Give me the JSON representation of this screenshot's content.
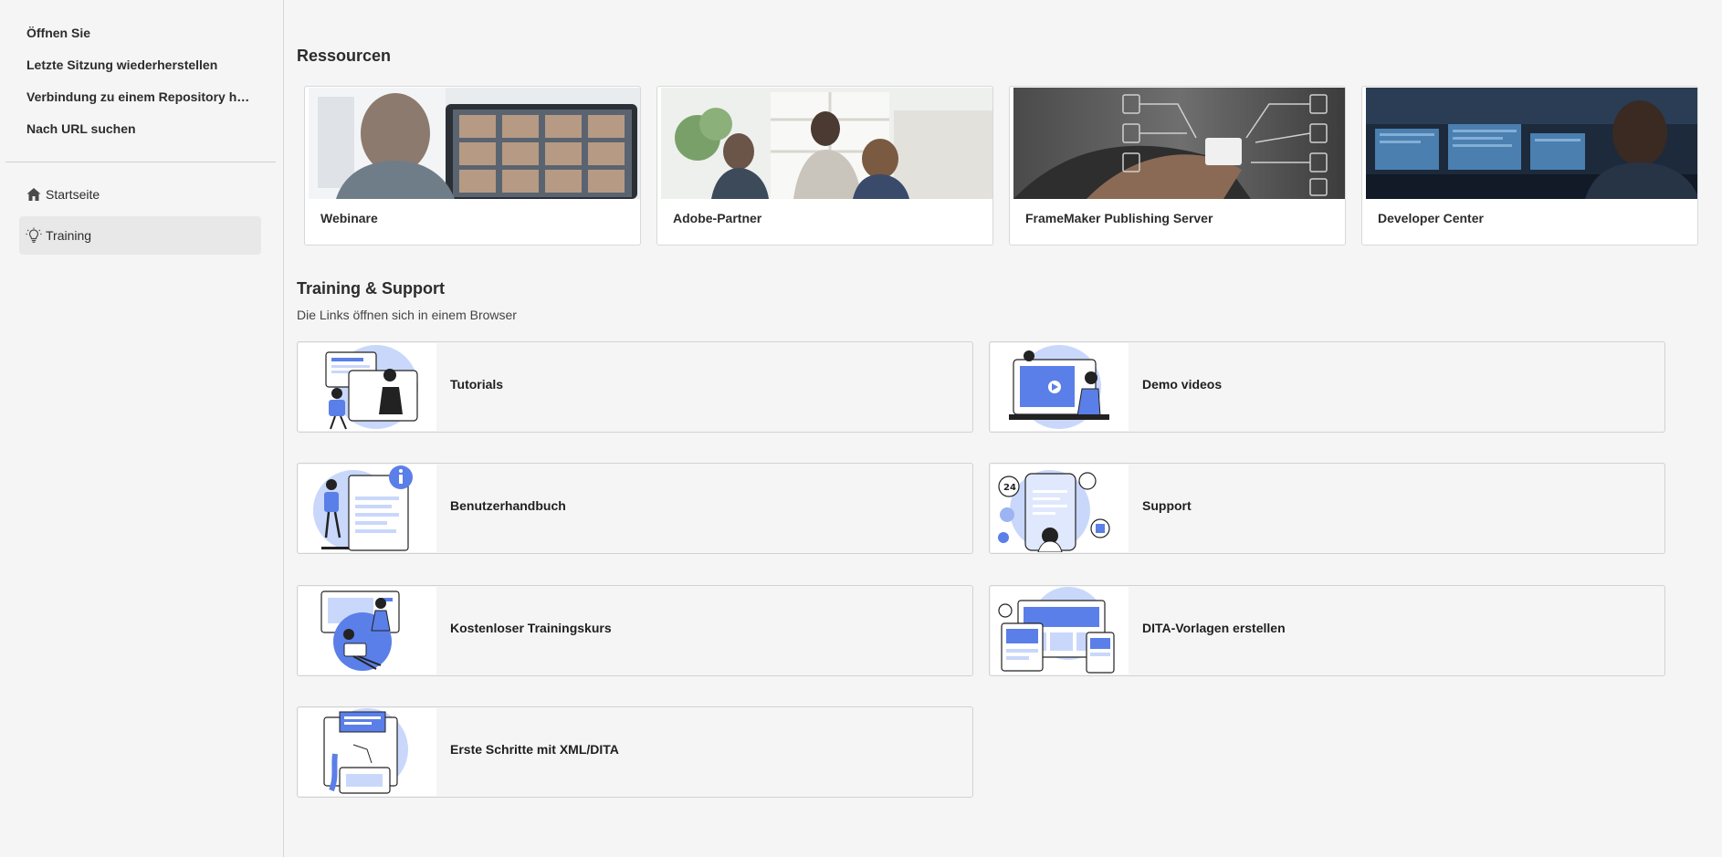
{
  "sidebar": {
    "links": [
      {
        "label": "Öffnen Sie"
      },
      {
        "label": "Letzte Sitzung wiederherstellen"
      },
      {
        "label": "Verbindung zu einem Repository herst..."
      },
      {
        "label": "Nach URL suchen"
      }
    ],
    "nav": [
      {
        "label": "Startseite",
        "icon": "home-icon",
        "active": false
      },
      {
        "label": "Training",
        "icon": "lightbulb-icon",
        "active": true
      }
    ]
  },
  "resources": {
    "title": "Ressourcen",
    "cards": [
      {
        "label": "Webinare"
      },
      {
        "label": "Adobe-Partner"
      },
      {
        "label": "FrameMaker Publishing Server"
      },
      {
        "label": "Developer Center"
      }
    ]
  },
  "training": {
    "title": "Training & Support",
    "subtitle": "Die Links öffnen sich in einem Browser",
    "cards": [
      {
        "label": "Tutorials"
      },
      {
        "label": "Demo videos"
      },
      {
        "label": "Benutzerhandbuch"
      },
      {
        "label": "Support"
      },
      {
        "label": "Kostenloser Trainingskurs"
      },
      {
        "label": "DITA-Vorlagen erstellen"
      },
      {
        "label": "Erste Schritte mit XML/DITA"
      }
    ]
  },
  "colors": {
    "accent": "#5b7fe8",
    "accent_light": "#c9d7fb",
    "background": "#f5f5f5"
  }
}
